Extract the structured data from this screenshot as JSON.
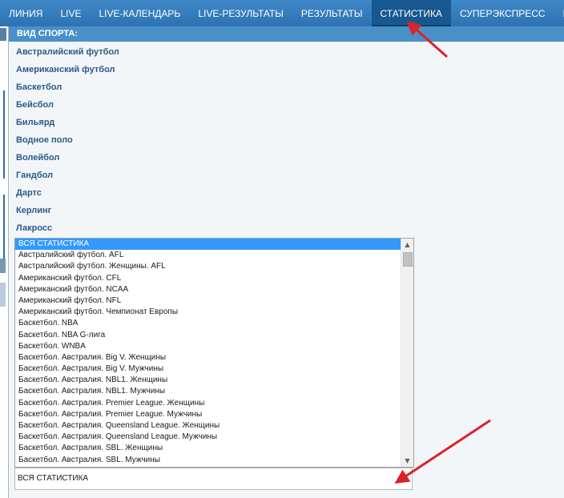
{
  "nav": {
    "items": [
      "ЛИНИЯ",
      "LIVE",
      "LIVE-КАЛЕНДАРЬ",
      "LIVE-РЕЗУЛЬТАТЫ",
      "РЕЗУЛЬТАТЫ",
      "СТАТИСТИКА",
      "СУПЕРЭКСПРЕСС",
      "ИН"
    ],
    "active": "СТАТИСТИКА"
  },
  "panel": {
    "header": "ВИД СПОРТА:",
    "sports": [
      "Австралийский футбол",
      "Американский футбол",
      "Баскетбол",
      "Бейсбол",
      "Бильярд",
      "Водное поло",
      "Волейбол",
      "Гандбол",
      "Дартс",
      "Керлинг",
      "Лакросс"
    ]
  },
  "listbox": {
    "items": [
      "ВСЯ СТАТИСТИКА",
      "Австралийский футбол. AFL",
      "Австралийский футбол. Женщины. AFL",
      "Американский футбол. CFL",
      "Американский футбол. NCAA",
      "Американский футбол. NFL",
      "Американский футбол. Чемпионат Европы",
      "Баскетбол. NBA",
      "Баскетбол. NBA G-лига",
      "Баскетбол. WNBA",
      "Баскетбол. Австралия. Big V. Женщины",
      "Баскетбол. Австралия. Big V. Мужчины",
      "Баскетбол. Австралия. NBL1. Женщины",
      "Баскетбол. Австралия. NBL1. Мужчины",
      "Баскетбол. Австралия. Premier League. Женщины",
      "Баскетбол. Австралия. Premier League. Мужчины",
      "Баскетбол. Австралия. Queensland League. Женщины",
      "Баскетбол. Австралия. Queensland League. Мужчины",
      "Баскетбол. Австралия. SBL. Женщины",
      "Баскетбол. Австралия. SBL. Мужчины"
    ],
    "selected_index": 0
  },
  "select": {
    "value": "ВСЯ СТАТИСТИКА"
  },
  "colors": {
    "nav": "#2d73b3",
    "header": "#4a90c8",
    "sport_text": "#2a5a86",
    "selection": "#3399ff",
    "arrow": "#d9232a"
  }
}
